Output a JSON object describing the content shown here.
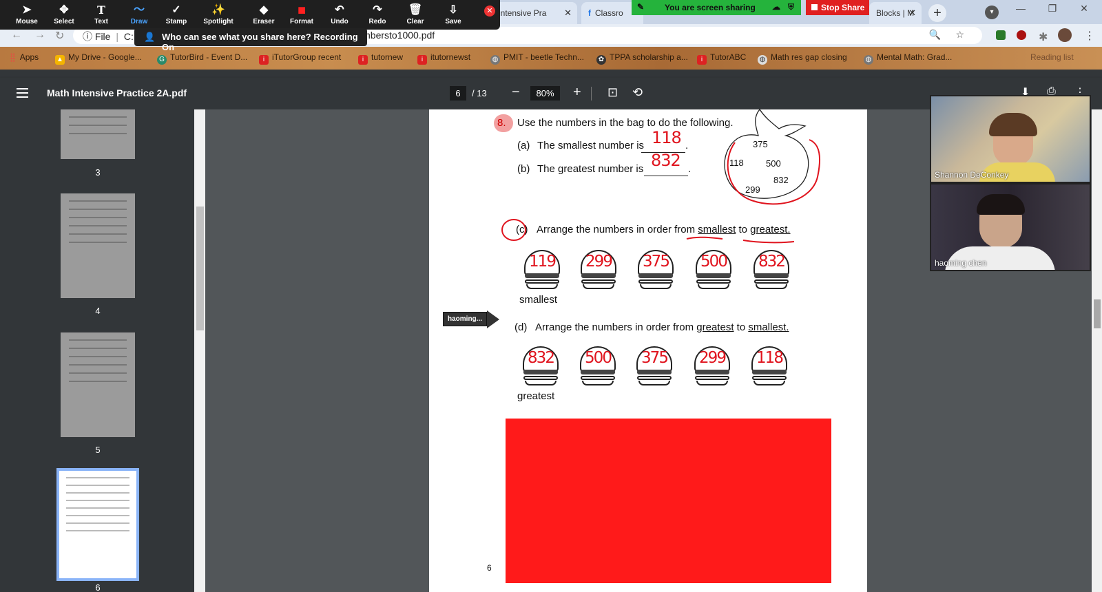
{
  "zoom_toolbar": {
    "tools": [
      {
        "label": "Mouse",
        "icon": "cursor-icon",
        "glyph": "➤"
      },
      {
        "label": "Select",
        "icon": "move-icon",
        "glyph": "✥"
      },
      {
        "label": "Text",
        "icon": "text-icon",
        "glyph": "T"
      },
      {
        "label": "Draw",
        "icon": "draw-icon",
        "glyph": "〜"
      },
      {
        "label": "Stamp",
        "icon": "stamp-icon",
        "glyph": "✓"
      },
      {
        "label": "Spotlight",
        "icon": "spotlight-icon",
        "glyph": "✨"
      },
      {
        "label": "Eraser",
        "icon": "eraser-icon",
        "glyph": "◆"
      },
      {
        "label": "Format",
        "icon": "format-icon",
        "glyph": "■"
      },
      {
        "label": "Undo",
        "icon": "undo-icon",
        "glyph": "↶"
      },
      {
        "label": "Redo",
        "icon": "redo-icon",
        "glyph": "↷"
      },
      {
        "label": "Clear",
        "icon": "trash-icon",
        "glyph": "🗑"
      },
      {
        "label": "Save",
        "icon": "save-icon",
        "glyph": "⇩"
      }
    ],
    "active_tool": "Draw",
    "recording_text": "Who can see what you share here? Recording On"
  },
  "screen_share": {
    "status": "You are screen sharing",
    "stop_label": "Stop Share"
  },
  "browser": {
    "tabs": [
      {
        "title": "th Intensive Pra"
      },
      {
        "title": "Classro"
      },
      {
        "title": "Blocks | M"
      }
    ],
    "url_prefix": "File",
    "url_start": "C:",
    "url_visible": "nbersto1000.pdf",
    "bookmarks": [
      "Apps",
      "My Drive - Google...",
      "TutorBird - Event D...",
      "iTutorGroup recent",
      "tutornew",
      "itutornewst",
      "PMIT - beetle Techn...",
      "TPPA scholarship a...",
      "TutorABC",
      "Math res gap closing",
      "Mental Math: Grad..."
    ],
    "reading_list": "Reading list"
  },
  "pdf": {
    "title": "Math Intensive Practice 2A.pdf",
    "current_page": "6",
    "total_pages": "/ 13",
    "zoom": "80%",
    "thumb_pages": [
      "3",
      "4",
      "5",
      "6"
    ],
    "selected_page": "6"
  },
  "worksheet": {
    "q8_number": "8.",
    "q8_text": "Use the numbers in the bag to do the following.",
    "a_label": "(a)",
    "a_text": "The smallest number is",
    "a_answer": "118",
    "b_label": "(b)",
    "b_text": "The greatest number is",
    "b_answer": "832",
    "bag_numbers": [
      "375",
      "118",
      "500",
      "832",
      "299"
    ],
    "c_label": "(c)",
    "c_text_1": "Arrange the numbers in order from",
    "c_word_1": "smallest",
    "c_to": "to",
    "c_word_2": "greatest.",
    "c_answers": [
      "119",
      "299",
      "375",
      "500",
      "832"
    ],
    "c_caption": "smallest",
    "d_label": "(d)",
    "d_text_1": "Arrange the numbers in order from",
    "d_word_1": "greatest",
    "d_to": "to",
    "d_word_2": "smallest.",
    "d_answers": [
      "832",
      "500",
      "375",
      "299",
      "118"
    ],
    "d_caption": "greatest",
    "page_footer": "6"
  },
  "remote_pointer": "haoming...",
  "participants": [
    {
      "name": "Shannon DeConkey"
    },
    {
      "name": "haoming    chen"
    }
  ],
  "colors": {
    "annotation_red": "#e0141e",
    "highlight_box": "#ff1a1a",
    "share_green": "#25b33c",
    "stop_red": "#e02020"
  }
}
